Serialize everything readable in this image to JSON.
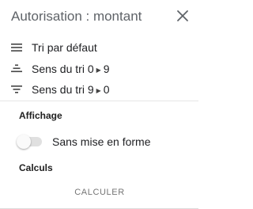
{
  "header": {
    "title": "Autorisation : montant",
    "close_icon": "close-icon"
  },
  "sort_menu": {
    "items": [
      {
        "label": "Tri par défaut",
        "icon": "sort-default-icon"
      },
      {
        "label_prefix": "Sens du tri 0",
        "arrow": "▶",
        "label_suffix": "9",
        "icon": "sort-ascending-icon"
      },
      {
        "label_prefix": "Sens du tri 9",
        "arrow": "▶",
        "label_suffix": "0",
        "icon": "sort-descending-icon"
      }
    ]
  },
  "display_section": {
    "title": "Affichage",
    "toggle_label": "Sans mise en forme",
    "toggle_on": false
  },
  "calc_section": {
    "title": "Calculs",
    "button_label": "CALCULER"
  },
  "colors": {
    "title_text": "#5f6368",
    "body_text": "#202124",
    "muted_button": "#757575",
    "toggle_track": "#e0e0e0",
    "divider": "#e6e6e6"
  }
}
